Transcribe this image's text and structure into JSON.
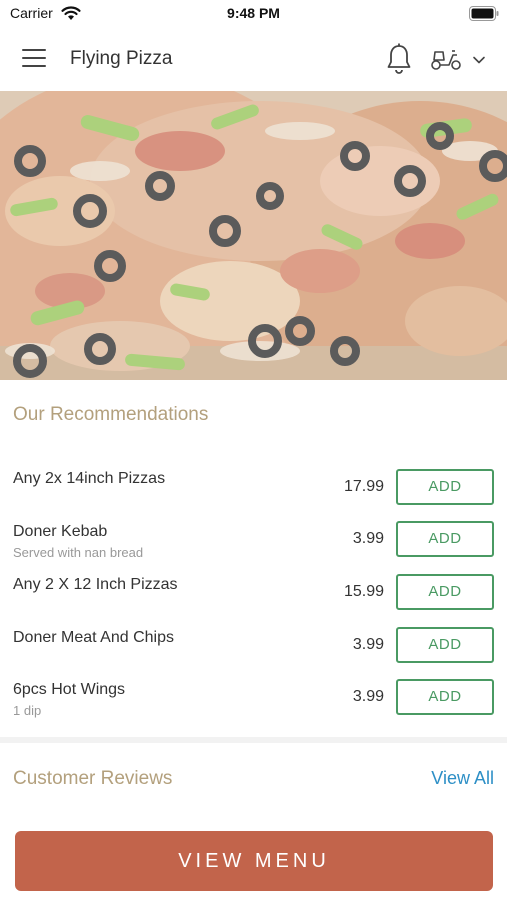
{
  "status_bar": {
    "carrier": "Carrier",
    "time": "9:48 PM",
    "wifi_icon": "wifi-icon",
    "battery_icon": "battery-icon"
  },
  "header": {
    "title": "Flying Pizza",
    "menu_icon": "hamburger-menu-icon",
    "notification_icon": "bell-icon",
    "delivery_icon": "scooter-icon",
    "dropdown_icon": "chevron-down-icon"
  },
  "hero": {
    "image": "pizza-photo"
  },
  "recommendations": {
    "title": "Our Recommendations",
    "items": [
      {
        "name": "Any 2x 14inch Pizzas",
        "description": "",
        "price": "17.99",
        "button": "ADD"
      },
      {
        "name": "Doner Kebab",
        "description": "Served with nan bread",
        "price": "3.99",
        "button": "ADD"
      },
      {
        "name": "Any 2 X 12 Inch Pizzas",
        "description": "",
        "price": "15.99",
        "button": "ADD"
      },
      {
        "name": "Doner Meat And Chips",
        "description": "",
        "price": "3.99",
        "button": "ADD"
      },
      {
        "name": "6pcs Hot Wings",
        "description": "1 dip",
        "price": "3.99",
        "button": "ADD"
      }
    ]
  },
  "reviews": {
    "title": "Customer Reviews",
    "view_all": "View All"
  },
  "footer": {
    "view_menu": "VIEW MENU"
  },
  "colors": {
    "accent_text": "#b3a07d",
    "add_green": "#4a9a63",
    "link_blue": "#2d8fc6",
    "primary_button": "#c2644b"
  }
}
